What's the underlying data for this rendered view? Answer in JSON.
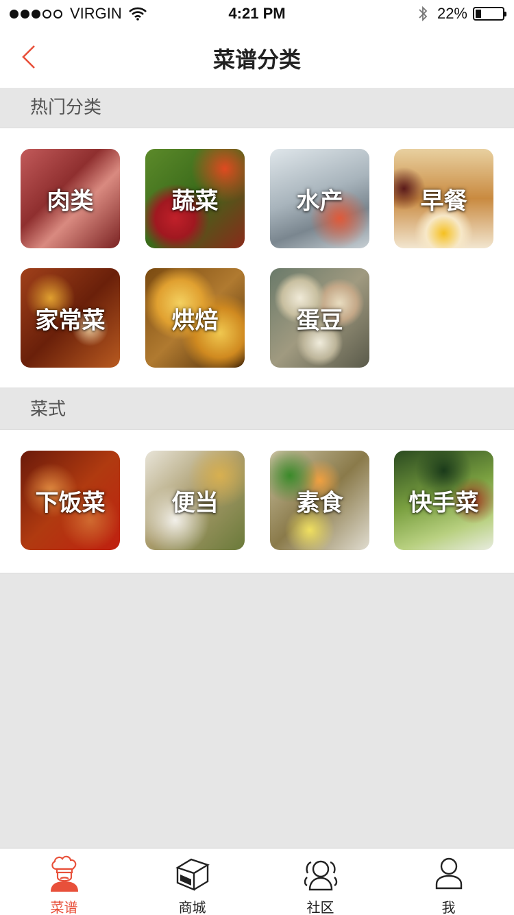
{
  "status_bar": {
    "carrier": "VIRGIN",
    "time": "4:21 PM",
    "battery": "22%",
    "battery_level": 0.22,
    "signal_bars_filled": 3,
    "signal_bars_total": 5,
    "icons": [
      "wifi-icon",
      "bluetooth-icon",
      "battery-icon"
    ]
  },
  "nav": {
    "title": "菜谱分类",
    "back_icon": "chevron-left-icon",
    "accent_color": "#e8503a"
  },
  "sections": [
    {
      "title": "热门分类",
      "items": [
        {
          "label": "肉类",
          "color": "#9b3a3a"
        },
        {
          "label": "蔬菜",
          "color": "#8a3b2a"
        },
        {
          "label": "水产",
          "color": "#a9b4bd"
        },
        {
          "label": "早餐",
          "color": "#c9a06a"
        },
        {
          "label": "家常菜",
          "color": "#8c3a1a"
        },
        {
          "label": "烘焙",
          "color": "#b58a3a"
        },
        {
          "label": "蛋豆",
          "color": "#8f8a78"
        }
      ]
    },
    {
      "title": "菜式",
      "items": [
        {
          "label": "下饭菜",
          "color": "#a4401f"
        },
        {
          "label": "便当",
          "color": "#a89a6a"
        },
        {
          "label": "素食",
          "color": "#9a8a52"
        },
        {
          "label": "快手菜",
          "color": "#5f7d3a"
        }
      ]
    }
  ],
  "tab_bar": {
    "tabs": [
      {
        "label": "菜谱",
        "icon": "chef-icon",
        "active": true
      },
      {
        "label": "商城",
        "icon": "box-icon",
        "active": false
      },
      {
        "label": "社区",
        "icon": "community-icon",
        "active": false
      },
      {
        "label": "我",
        "icon": "user-icon",
        "active": false
      }
    ]
  }
}
